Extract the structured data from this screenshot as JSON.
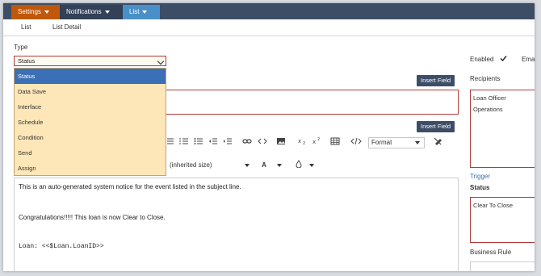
{
  "nav": {
    "settings": "Settings",
    "notifications": "Notifications",
    "list": "List"
  },
  "subnav": {
    "list": "List",
    "list_detail": "List Detail"
  },
  "type_section": {
    "label": "Type",
    "selected": "Status",
    "options": [
      "Status",
      "Data Save",
      "Interface",
      "Schedule",
      "Condition",
      "Send",
      "Assign"
    ]
  },
  "insert_field_1": "Insert Field",
  "insert_field_2": "Insert Field",
  "toolbar": {
    "format": "Format",
    "size": "(inherited size)",
    "font_color": "A"
  },
  "editor": {
    "line1": "This is an auto-generated system notice for the event listed in the subject line.",
    "line2": "Congratulations!!!!! This loan is now Clear to Close.",
    "line3": "Loan: <<$Loan.LoanID>>"
  },
  "side": {
    "enabled": "Enabled",
    "email_partial": "Ema",
    "recipients_label": "Recipients",
    "recipients": [
      "Loan Officer",
      "Operations"
    ],
    "trigger_label": "Trigger",
    "status_label": "Status",
    "status_value": "Clear To Close",
    "business_rule_label": "Business Rule"
  },
  "colors": {
    "nav_bg": "#3d4d66",
    "settings_tab": "#c0580c",
    "list_tab": "#4a90c8",
    "dropdown_bg": "#fde6b8",
    "dropdown_selected": "#3b6fb6",
    "required_border": "#b23a3a",
    "trigger_link": "#3b6fb6"
  }
}
